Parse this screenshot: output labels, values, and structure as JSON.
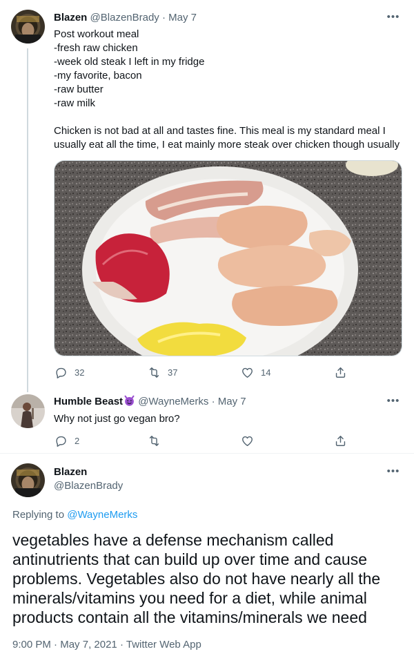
{
  "tweet1": {
    "display_name": "Blazen",
    "handle": "@BlazenBrady",
    "sep": "·",
    "date": "May 7",
    "more": "•••",
    "lines": [
      "Post workout meal",
      "-fresh raw chicken",
      "-week old steak I left in my fridge",
      "-my favorite, bacon",
      "-raw butter",
      "-raw milk",
      "",
      "Chicken is not bad at all and tastes fine. This meal is my standard meal I",
      "usually eat all the time, I eat mainly more steak over chicken though usually"
    ],
    "replies": "32",
    "retweets": "37",
    "likes": "14"
  },
  "tweet2": {
    "display_name": "Humble Beast",
    "emoji": "smiling-devil-emoji",
    "handle": "@WayneMerks",
    "sep": "·",
    "date": "May 7",
    "more": "•••",
    "text": "Why not just go vegan bro?",
    "replies": "2"
  },
  "main_tweet": {
    "display_name": "Blazen",
    "handle": "@BlazenBrady",
    "more": "•••",
    "replying_prefix": "Replying to ",
    "replying_to": "@WayneMerks",
    "lines": [
      "vegetables have a defense mechanism called",
      "antinutrients that can build up over time and cause",
      "problems. Vegetables also do not have nearly all the",
      "minerals/vitamins you need for a diet, while animal",
      "products contain all the vitamins/minerals we need"
    ],
    "time": "9:00 PM",
    "sep": "·",
    "date": "May 7, 2021",
    "source": "Twitter Web App"
  },
  "icons": {
    "reply": "reply-icon",
    "retweet": "retweet-icon",
    "like": "heart-icon",
    "share": "share-icon"
  },
  "colors": {
    "link": "#1d9bf0",
    "muted": "#536471",
    "thread_line": "#cfd9de"
  }
}
